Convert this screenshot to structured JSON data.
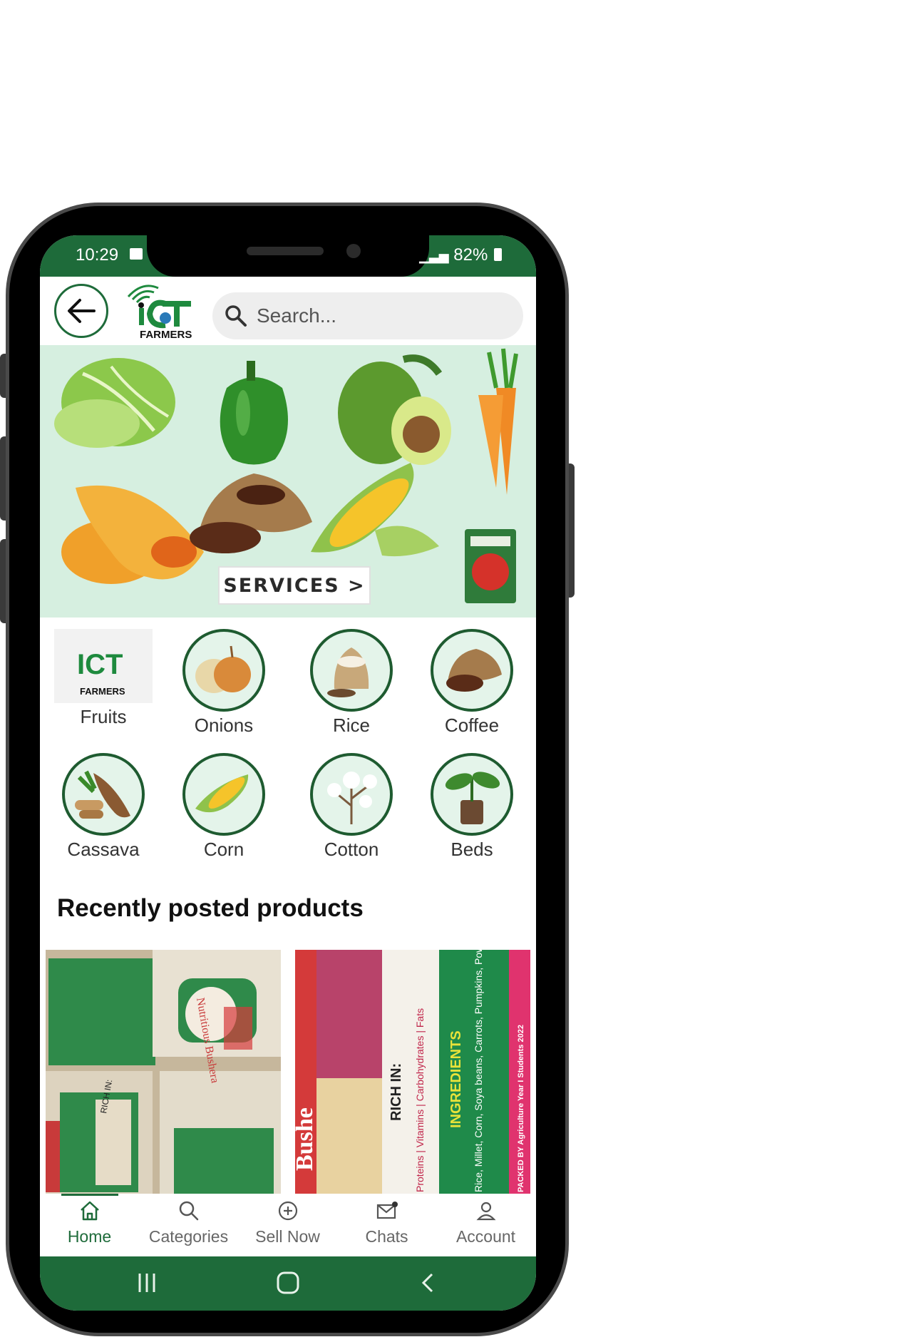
{
  "status_bar": {
    "time": "10:29",
    "battery": "82%"
  },
  "header": {
    "search_placeholder": "Search..."
  },
  "logo": {
    "text_top": "ICT",
    "text_bottom": "FARMERS"
  },
  "banner": {
    "button_label": "SERVICES >"
  },
  "categories": [
    {
      "label": "Fruits"
    },
    {
      "label": "Onions"
    },
    {
      "label": "Rice"
    },
    {
      "label": "Coffee"
    },
    {
      "label": "Cassava"
    },
    {
      "label": "Corn"
    },
    {
      "label": "Cotton"
    },
    {
      "label": "Beds"
    }
  ],
  "section": {
    "title": "Recently posted products"
  },
  "products": [
    {
      "pack_text": "Nutritious Bushera",
      "label_text": "RICH IN:"
    },
    {
      "brand_text": "Bushe",
      "rich_in": "RICH IN:",
      "nutrients": "Proteins | Vitamins | Carbohydrates | Fats",
      "ingredients_title": "INGREDIENTS",
      "ingredients": "Rice, Millet, Corn, Soya beans, Carrots, Pumpkins, Powdered Milk",
      "packed_by": "PACKED BY Agriculture Year I Students 2022"
    }
  ],
  "bottom_nav": [
    {
      "label": "Home",
      "icon": "home-icon",
      "active": true
    },
    {
      "label": "Categories",
      "icon": "search-icon",
      "active": false
    },
    {
      "label": "Sell Now",
      "icon": "plus-circle-icon",
      "active": false
    },
    {
      "label": "Chats",
      "icon": "mail-icon",
      "active": false
    },
    {
      "label": "Account",
      "icon": "user-icon",
      "active": false
    }
  ],
  "colors": {
    "brand_green": "#1e6b3a",
    "banner_bg": "#d6efe0",
    "active_nav": "#1e6b3a"
  }
}
